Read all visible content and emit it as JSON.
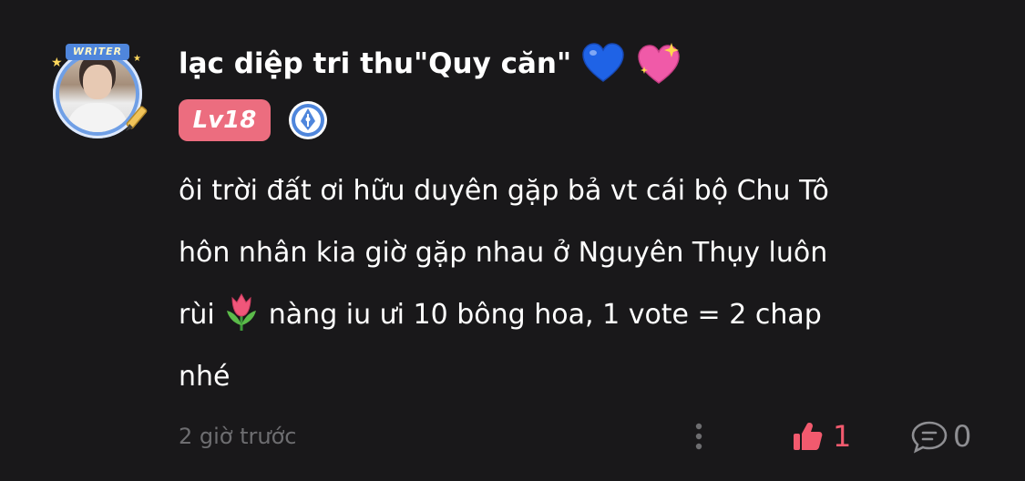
{
  "comment": {
    "avatar": {
      "banner_text": "WRITER",
      "decoration_icon": "pen-icon"
    },
    "username": "lạc diệp tri thu\"Quy căn\"",
    "name_emojis": [
      "💙",
      "💖"
    ],
    "level_badge": "Lv18",
    "badge_icon": "fountain-pen-icon",
    "text_lines": [
      "ôi trời đất ơi hữu duyên gặp bả vt cái bộ Chu Tô",
      "hôn nhân kia giờ gặp nhau ở Nguyên Thụy luôn",
      "rùi",
      "nàng iu ưi 10 bông hoa, 1 vote = 2 chap",
      "nhé"
    ],
    "text_emoji": "🌷",
    "timestamp": "2 giờ trước",
    "likes": "1",
    "replies": "0"
  },
  "colors": {
    "background": "#19181a",
    "level_badge": "#ec6d7f",
    "like_active": "#f25a6e",
    "muted": "#6d6d70",
    "badge_icon": "#4f86dc"
  },
  "icons": {
    "more": "vertical-dots-icon",
    "like": "thumbs-up-icon",
    "reply": "speech-bubble-icon"
  }
}
